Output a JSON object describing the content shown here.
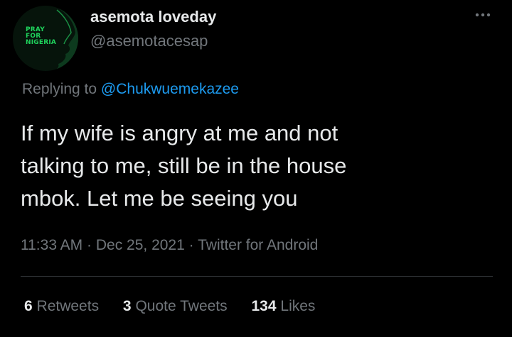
{
  "tweet": {
    "author": {
      "avatar_text": [
        "PRAY",
        "FOR",
        "NIGERIA"
      ],
      "display_name": "asemota loveday",
      "handle": "@asemotacesap"
    },
    "replying_to": {
      "prefix": "Replying to",
      "mention": "@Chukwuemekazee"
    },
    "text_lines": [
      "If my wife is angry at me and not",
      "talking to me, still be in the house",
      "mbok. Let me be seeing you"
    ],
    "meta": {
      "time": "11:33 AM",
      "date": "Dec 25, 2021",
      "source": "Twitter for Android",
      "separator": "·"
    },
    "stats": {
      "retweets": {
        "count": "6",
        "label": "Retweets"
      },
      "quote_tweets": {
        "count": "3",
        "label": "Quote Tweets"
      },
      "likes": {
        "count": "134",
        "label": "Likes"
      }
    }
  },
  "icons": {
    "more": "more-horizontal-icon"
  },
  "colors": {
    "background": "#000000",
    "primary_text": "#e7e9ea",
    "secondary_text": "#71767b",
    "link": "#1d9bf0",
    "avatar_accent": "#1fd35c",
    "divider": "#2f3336"
  }
}
